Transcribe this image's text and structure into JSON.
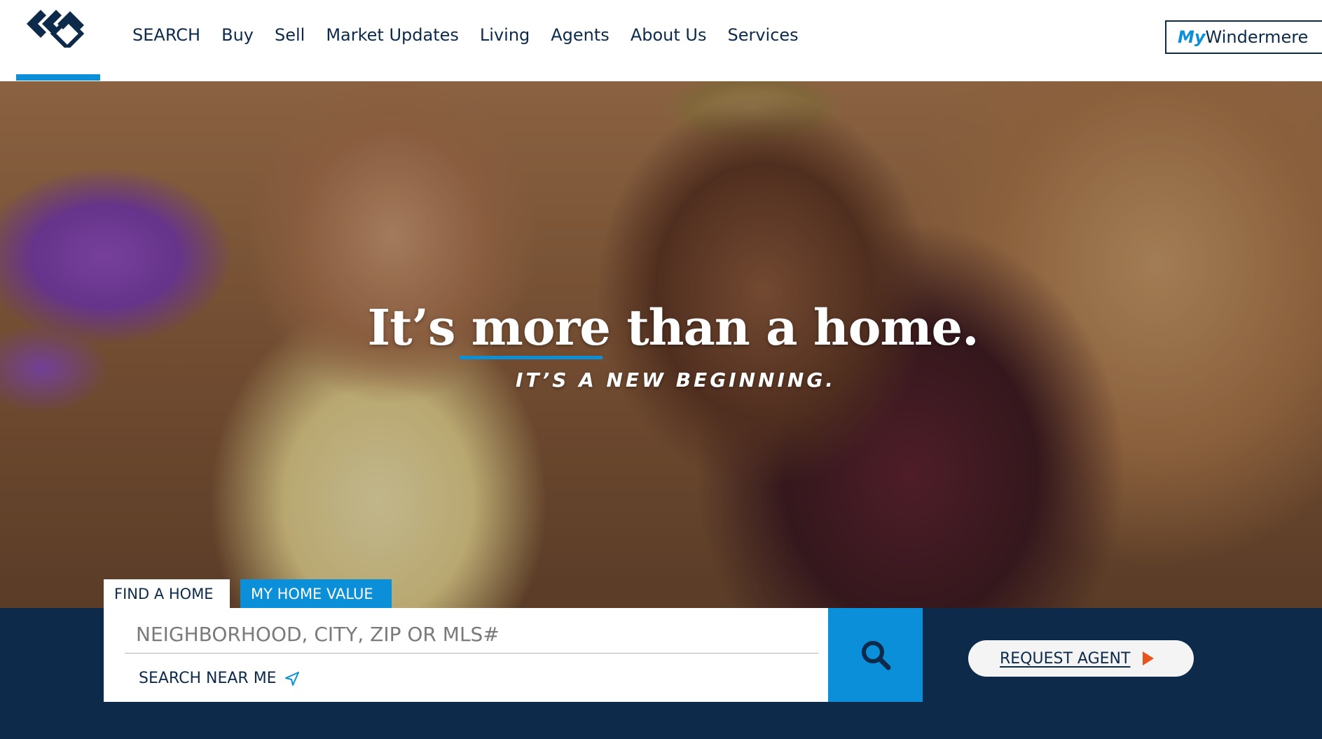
{
  "header": {
    "logo_icon": "windermere-diamond-logo",
    "nav": [
      {
        "label": "SEARCH"
      },
      {
        "label": "Buy"
      },
      {
        "label": "Sell"
      },
      {
        "label": "Market Updates"
      },
      {
        "label": "Living"
      },
      {
        "label": "Agents"
      },
      {
        "label": "About Us"
      },
      {
        "label": "Services"
      }
    ],
    "account_button": {
      "prefix": "My",
      "label": "Windermere"
    }
  },
  "hero": {
    "title": "It’s more than a home.",
    "subtitle": "IT’S A NEW BEGINNING."
  },
  "search": {
    "tabs": [
      {
        "label": "FIND A HOME",
        "active": true
      },
      {
        "label": "MY HOME VALUE",
        "active": false
      }
    ],
    "placeholder": "NEIGHBORHOOD, CITY, ZIP OR MLS#",
    "value": "",
    "near_me_label": "SEARCH NEAR ME",
    "near_me_icon": "location-arrow-icon",
    "submit_icon": "search-icon"
  },
  "request_agent": {
    "label": "REQUEST AGENT",
    "icon": "play-arrow-icon"
  },
  "colors": {
    "navy": "#0d2a4a",
    "blue": "#0a8fd8",
    "orange": "#e8531f"
  }
}
